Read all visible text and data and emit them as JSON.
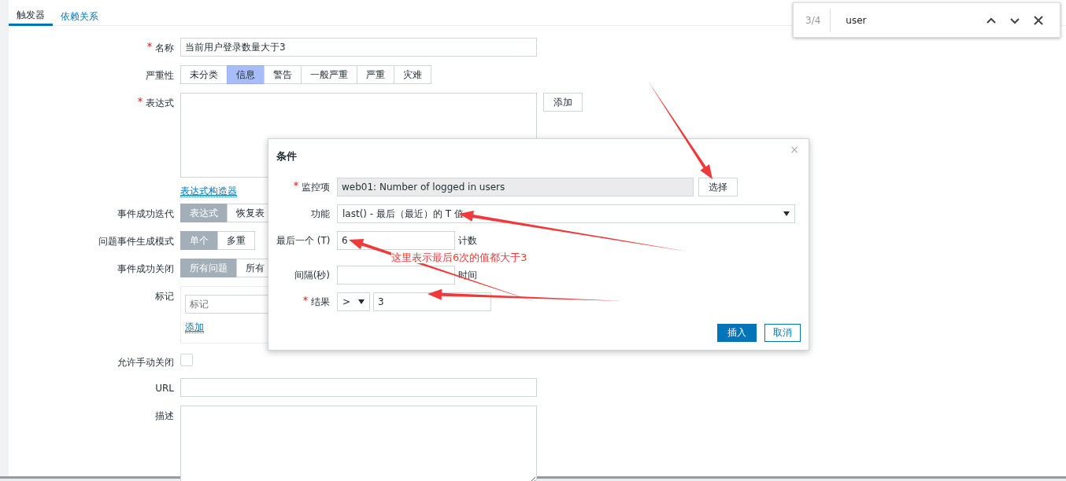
{
  "tabs": [
    {
      "label": "触发器",
      "selected": true
    },
    {
      "label": "依赖关系",
      "selected": false
    }
  ],
  "form": {
    "fields": [
      {
        "kind": "text",
        "label": "名称",
        "required": true,
        "value": "当前用户登录数量大于3"
      },
      {
        "kind": "severity",
        "label": "严重性",
        "required": false,
        "options": [
          {
            "label": "未分类",
            "selected": false
          },
          {
            "label": "信息",
            "selected": true
          },
          {
            "label": "警告",
            "selected": false
          },
          {
            "label": "一般严重",
            "selected": false
          },
          {
            "label": "严重",
            "selected": false
          },
          {
            "label": "灾难",
            "selected": false
          }
        ]
      },
      {
        "kind": "textarea",
        "label": "表达式",
        "required": true,
        "button": "添加",
        "link": "表达式构造器"
      },
      {
        "kind": "segmented",
        "label": "事件成功迭代",
        "required": false,
        "options": [
          {
            "label": "表达式",
            "selected": true
          },
          {
            "label": "恢复表",
            "selected": false
          }
        ]
      },
      {
        "kind": "segmented",
        "label": "问题事件生成模式",
        "required": false,
        "options": [
          {
            "label": "单个",
            "selected": true
          },
          {
            "label": "多重",
            "selected": false
          }
        ]
      },
      {
        "kind": "segmented",
        "label": "事件成功关闭",
        "required": false,
        "options": [
          {
            "label": "所有问题",
            "selected": true
          },
          {
            "label": "所有",
            "selected": false
          }
        ]
      },
      {
        "kind": "tags",
        "label": "标记",
        "required": false,
        "placeholder": "标记",
        "link": "添加"
      },
      {
        "kind": "checkbox",
        "label": "允许手动关闭",
        "required": false,
        "checked": false
      },
      {
        "kind": "text",
        "label": "URL",
        "required": false
      },
      {
        "kind": "textarea",
        "label": "描述",
        "required": false
      }
    ]
  },
  "dialog": {
    "title": "条件",
    "close": "×",
    "rows": [
      {
        "kind": "item",
        "label": "监控项",
        "required": true,
        "value": "web01: Number of logged in users",
        "button": "选择"
      },
      {
        "kind": "select",
        "label": "功能",
        "required": false,
        "value": "last() - 最后（最近）的 T 值"
      },
      {
        "kind": "input",
        "label": "最后一个 (T)",
        "required": false,
        "value": "6",
        "suffix": "计数"
      },
      {
        "kind": "input",
        "label": "间隔(秒)",
        "required": false,
        "suffix": "时间"
      },
      {
        "kind": "result",
        "label": "结果",
        "required": true,
        "operator": ">",
        "value": "3"
      }
    ],
    "buttons": [
      {
        "label": "插入",
        "kind": "primary"
      },
      {
        "label": "取消",
        "kind": "secondary"
      }
    ]
  },
  "find_bar": {
    "count": "3/4",
    "query": "user"
  },
  "annotation": {
    "text": "这里表示最后6次的值都大于3"
  }
}
